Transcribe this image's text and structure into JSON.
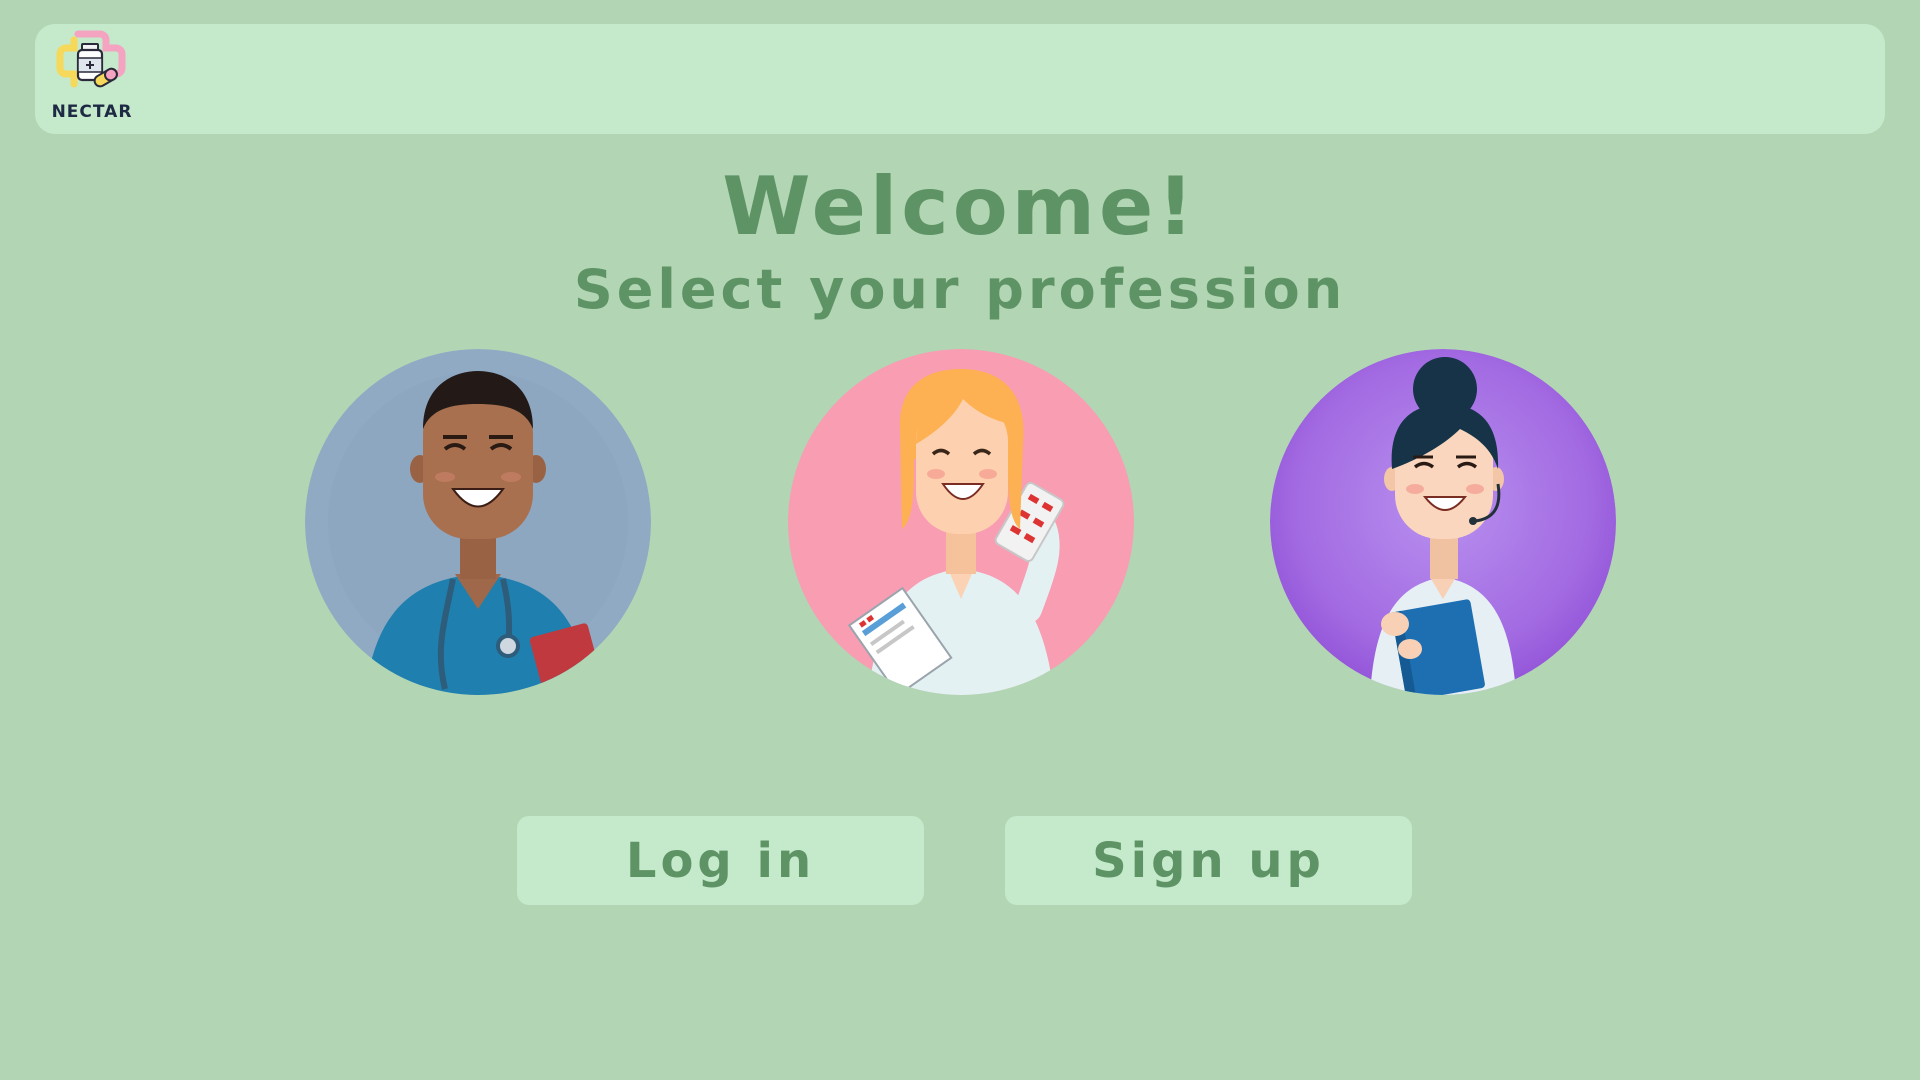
{
  "app": {
    "logo_text": "NECTAR"
  },
  "main": {
    "welcome": "Welcome!",
    "subtitle": "Select your profession"
  },
  "professions": [
    {
      "icon": "doctor-avatar",
      "bg_color": "#91aac4"
    },
    {
      "icon": "pharmacist-avatar",
      "bg_color": "#f89db2"
    },
    {
      "icon": "receptionist-avatar",
      "bg_color": "#a36be2"
    }
  ],
  "actions": {
    "login_label": "Log in",
    "signup_label": "Sign up"
  },
  "colors": {
    "background": "#b2d5b4",
    "panel": "#c5eacb",
    "text_accent": "#5e9465"
  }
}
